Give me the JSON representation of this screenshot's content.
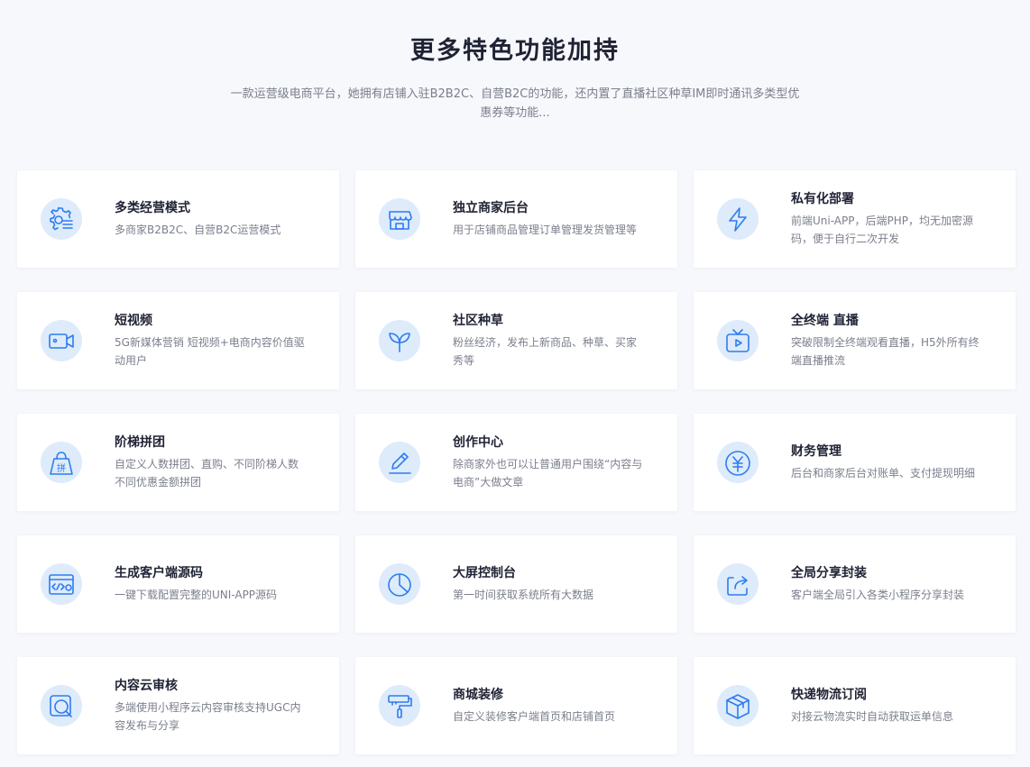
{
  "header": {
    "title": "更多特色功能加持",
    "subtitle": "一款运营级电商平台，她拥有店铺入驻B2B2C、自营B2C的功能，还内置了直播社区种草IM即时通讯多类型优惠券等功能..."
  },
  "colors": {
    "accent": "#2d7df0",
    "icon_bg": "#deebfb",
    "page_bg": "#f7f8fc"
  },
  "features": [
    {
      "icon": "gear-list-icon",
      "title": "多类经营模式",
      "desc": "多商家B2B2C、自营B2C运营模式"
    },
    {
      "icon": "storefront-icon",
      "title": "独立商家后台",
      "desc": "用于店铺商品管理订单管理发货管理等"
    },
    {
      "icon": "lightning-icon",
      "title": "私有化部署",
      "desc": "前端Uni-APP，后端PHP，均无加密源码，便于自行二次开发"
    },
    {
      "icon": "video-camera-icon",
      "title": "短视频",
      "desc": "5G新媒体营销 短视频+电商内容价值驱动用户"
    },
    {
      "icon": "sprout-icon",
      "title": "社区种草",
      "desc": "粉丝经济，发布上新商品、种草、买家秀等"
    },
    {
      "icon": "tv-play-icon",
      "title": "全终端 直播",
      "desc": "突破限制全终端观看直播，H5外所有终端直播推流"
    },
    {
      "icon": "group-bag-icon",
      "title": "阶梯拼团",
      "desc": "自定义人数拼团、直购、不同阶梯人数不同优惠金额拼团"
    },
    {
      "icon": "pen-icon",
      "title": "创作中心",
      "desc": "除商家外也可以让普通用户围绕“内容与电商”大做文章"
    },
    {
      "icon": "yuan-coin-icon",
      "title": "财务管理",
      "desc": "后台和商家后台对账单、支付提现明细"
    },
    {
      "icon": "code-window-icon",
      "title": "生成客户端源码",
      "desc": "一键下载配置完整的UNI-APP源码"
    },
    {
      "icon": "pie-chart-icon",
      "title": "大屏控制台",
      "desc": "第一时间获取系统所有大数据"
    },
    {
      "icon": "share-icon",
      "title": "全局分享封装",
      "desc": "客户端全局引入各类小程序分享封装"
    },
    {
      "icon": "search-audit-icon",
      "title": "内容云审核",
      "desc": "多端使用小程序云内容审核支持UGC内容发布与分享"
    },
    {
      "icon": "paint-roller-icon",
      "title": "商城装修",
      "desc": "自定义装修客户端首页和店铺首页"
    },
    {
      "icon": "package-box-icon",
      "title": "快递物流订阅",
      "desc": "对接云物流实时自动获取运单信息"
    }
  ]
}
